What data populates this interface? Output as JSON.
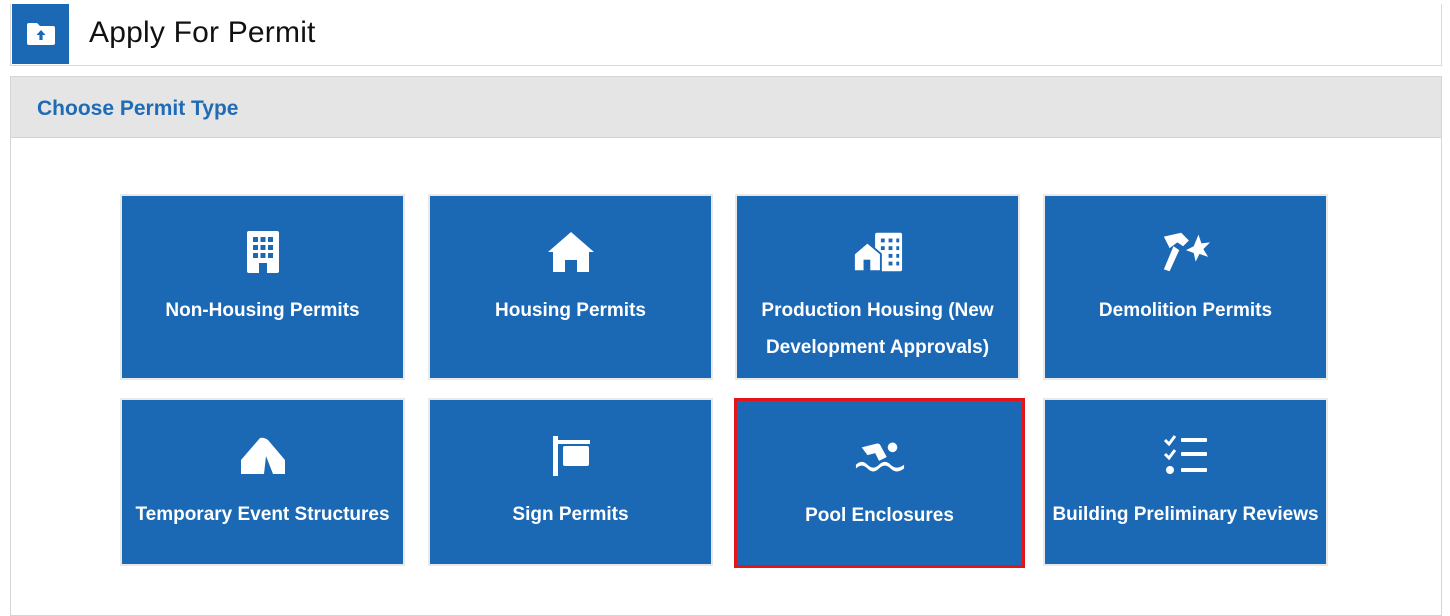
{
  "header": {
    "title": "Apply For Permit",
    "icon": "folder-upload-icon"
  },
  "panel": {
    "title": "Choose Permit Type"
  },
  "tiles": [
    {
      "label": "Non-Housing Permits",
      "icon": "building-icon",
      "selected": false
    },
    {
      "label": "Housing Permits",
      "icon": "house-icon",
      "selected": false
    },
    {
      "label": "Production Housing (New Development Approvals)",
      "icon": "city-icon",
      "selected": false
    },
    {
      "label": "Demolition Permits",
      "icon": "hammer-icon",
      "selected": false
    },
    {
      "label": "Temporary Event Structures",
      "icon": "tent-icon",
      "selected": false
    },
    {
      "label": "Sign Permits",
      "icon": "signpost-icon",
      "selected": false
    },
    {
      "label": "Pool Enclosures",
      "icon": "swimmer-icon",
      "selected": true
    },
    {
      "label": "Building Preliminary Reviews",
      "icon": "checklist-icon",
      "selected": false
    }
  ],
  "colors": {
    "tile_blue": "#1b68b5",
    "title_blue": "#1f6bb5",
    "selected_border": "#e3141b",
    "panel_header_bg": "#e5e5e5"
  }
}
